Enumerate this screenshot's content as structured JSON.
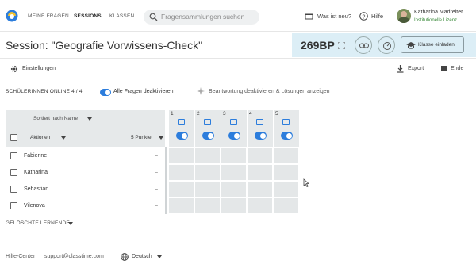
{
  "nav": {
    "links": [
      "MEINE FRAGEN",
      "SESSIONS",
      "KLASSEN"
    ],
    "search_placeholder": "Fragensammlungen suchen",
    "whats_new": "Was ist neu?",
    "help": "Hilfe",
    "user_name": "Katharina Madreiter",
    "user_license": "Institutionelle Lizenz"
  },
  "header": {
    "title": "Session: \"Geografie Vorwissens-Check\"",
    "code": "269BP",
    "invite_label": "Klasse einladen"
  },
  "toolbar": {
    "settings": "Einstellungen",
    "export": "Export",
    "end": "Ende"
  },
  "roster": {
    "online_label": "SCHÜLERINNEN ONLINE 4 / 4",
    "all_questions_toggle": "Alle Fragen deaktivieren",
    "disable_answers": "Beantwortung deaktivieren & Lösungen anzeigen",
    "sort_label": "Sortiert nach Name",
    "actions_label": "Aktionen",
    "points_label": "5 Punkte",
    "questions": [
      "1",
      "2",
      "3",
      "4",
      "5"
    ],
    "students": [
      {
        "name": "Fabienne",
        "score": "–"
      },
      {
        "name": "Katharina",
        "score": "–"
      },
      {
        "name": "Sebastian",
        "score": "–"
      },
      {
        "name": "Vilenova",
        "score": "–"
      }
    ],
    "deleted_label": "GELÖSCHTE LERNENDE"
  },
  "footer": {
    "help_center": "Hilfe-Center",
    "support_email": "support@classtime.com",
    "language": "Deutsch"
  },
  "colors": {
    "accent": "#2c7ddc",
    "code_bg": "#dceef6",
    "grid_bg": "#e6e9ea",
    "license_green": "#3a8a3a"
  }
}
